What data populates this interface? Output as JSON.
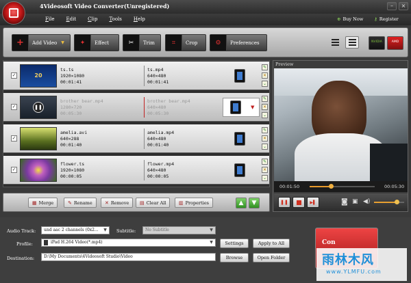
{
  "app": {
    "title": "4Videosoft Video Converter(Unregistered)"
  },
  "menu": {
    "items": [
      "File",
      "Edit",
      "Clip",
      "Tools",
      "Help"
    ],
    "buy_now": "Buy Now",
    "register": "Register"
  },
  "toolbar": {
    "add_video": "Add Video",
    "effect": "Effect",
    "trim": "Trim",
    "crop": "Crop",
    "preferences": "Preferences"
  },
  "badges": {
    "nvidia": "NVIDIA",
    "amd": "AMD"
  },
  "files": [
    {
      "src_name": "ts.ts",
      "src_res": "1920×1080",
      "src_dur": "00:01:41",
      "out_name": "ts.mp4",
      "out_res": "640×480",
      "out_dur": "00:01:41",
      "checked": true,
      "selected": false
    },
    {
      "src_name": "brother bear.mp4",
      "src_res": "1280×720",
      "src_dur": "00:05:30",
      "out_name": "brother bear.mp4",
      "out_res": "640×480",
      "out_dur": "00:05:30",
      "checked": true,
      "selected": true
    },
    {
      "src_name": "amelia.avi",
      "src_res": "640×288",
      "src_dur": "00:01:40",
      "out_name": "amelia.mp4",
      "out_res": "640×480",
      "out_dur": "00:01:40",
      "checked": true,
      "selected": false
    },
    {
      "src_name": "flower.ts",
      "src_res": "1920×1080",
      "src_dur": "00:00:05",
      "out_name": "flower.mp4",
      "out_res": "640×480",
      "out_dur": "00:00:05",
      "checked": true,
      "selected": false
    }
  ],
  "listbar": {
    "merge": "Merge",
    "rename": "Rename",
    "remove": "Remove",
    "clear_all": "Clear All",
    "properties": "Properties"
  },
  "preview": {
    "label": "Preview",
    "current_time": "00:01:50",
    "total_time": "00:05:30",
    "progress": 0.33,
    "volume": 0.75
  },
  "settings": {
    "audio_track_label": "Audio Track:",
    "audio_track_value": "und aac 2 channels (0x2...",
    "subtitle_label": "Subtitle:",
    "subtitle_value": "No Subtitle",
    "profile_label": "Profile:",
    "profile_value": "iPad H.264 Video(*.mp4)",
    "settings_btn": "Settings",
    "apply_all_btn": "Apply to All",
    "destination_label": "Destination:",
    "destination_value": "D:\\My Documents\\4Videosoft Studio\\Video",
    "browse_btn": "Browse",
    "open_folder_btn": "Open Folder"
  },
  "convert": {
    "label": "Con"
  },
  "watermark": {
    "line1": "雨林木风",
    "line2": "www.YLMFU.com"
  }
}
